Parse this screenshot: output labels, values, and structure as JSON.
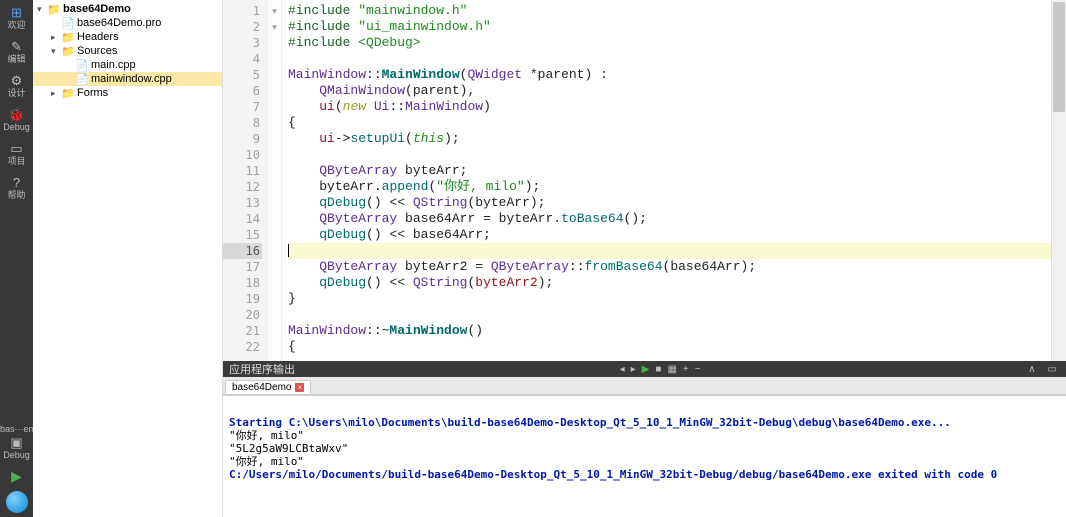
{
  "modeBar": {
    "items": [
      {
        "icon": "⊞",
        "label": "欢迎"
      },
      {
        "icon": "✎",
        "label": "编辑"
      },
      {
        "icon": "⚙",
        "label": "设计"
      },
      {
        "icon": "🐞",
        "label": "Debug"
      },
      {
        "icon": "▭",
        "label": "项目"
      },
      {
        "icon": "?",
        "label": "帮助"
      }
    ],
    "target": {
      "top": "bas···emo",
      "sub": "Debug"
    },
    "play": "▶"
  },
  "tree": [
    {
      "depth": 0,
      "arrow": "▾",
      "icon": "📁",
      "iconCls": "fold-blue",
      "label": "base64Demo",
      "bold": true,
      "sel": false
    },
    {
      "depth": 1,
      "arrow": "",
      "icon": "📄",
      "iconCls": "file-ic",
      "label": "base64Demo.pro",
      "bold": false,
      "sel": false
    },
    {
      "depth": 1,
      "arrow": "▸",
      "icon": "📁",
      "iconCls": "fold-yellow",
      "label": "Headers",
      "bold": false,
      "sel": false
    },
    {
      "depth": 1,
      "arrow": "▾",
      "icon": "📁",
      "iconCls": "fold-yellow",
      "label": "Sources",
      "bold": false,
      "sel": false
    },
    {
      "depth": 2,
      "arrow": "",
      "icon": "📄",
      "iconCls": "file-ic",
      "label": "main.cpp",
      "bold": false,
      "sel": false
    },
    {
      "depth": 2,
      "arrow": "",
      "icon": "📄",
      "iconCls": "file-ic",
      "label": "mainwindow.cpp",
      "bold": false,
      "sel": true
    },
    {
      "depth": 1,
      "arrow": "▸",
      "icon": "📁",
      "iconCls": "fold-yellow",
      "label": "Forms",
      "bold": false,
      "sel": false
    }
  ],
  "gutterCount": 22,
  "currentLine": 16,
  "foldMarks": {
    "7": "▾",
    "21": "▾"
  },
  "code": [
    [
      {
        "t": "#include ",
        "c": "tk-pp"
      },
      {
        "t": "\"mainwindow.h\"",
        "c": "tk-incpath"
      }
    ],
    [
      {
        "t": "#include ",
        "c": "tk-pp"
      },
      {
        "t": "\"ui_mainwindow.h\"",
        "c": "tk-incpath"
      }
    ],
    [
      {
        "t": "#include ",
        "c": "tk-pp"
      },
      {
        "t": "<QDebug>",
        "c": "tk-incpath"
      }
    ],
    [],
    [
      {
        "t": "MainWindow",
        "c": "tk-type"
      },
      {
        "t": "::"
      },
      {
        "t": "MainWindow",
        "c": "tk-fnbold"
      },
      {
        "t": "("
      },
      {
        "t": "QWidget",
        "c": "tk-type"
      },
      {
        "t": " *"
      },
      {
        "t": "parent",
        "c": ""
      },
      {
        "t": ") :"
      }
    ],
    [
      {
        "t": "    "
      },
      {
        "t": "QMainWindow",
        "c": "tk-type"
      },
      {
        "t": "("
      },
      {
        "t": "parent",
        "c": ""
      },
      {
        "t": "),"
      }
    ],
    [
      {
        "t": "    "
      },
      {
        "t": "ui",
        "c": "tk-var"
      },
      {
        "t": "("
      },
      {
        "t": "new",
        "c": "tk-kw"
      },
      {
        "t": " "
      },
      {
        "t": "Ui",
        "c": "tk-type"
      },
      {
        "t": "::"
      },
      {
        "t": "MainWindow",
        "c": "tk-type"
      },
      {
        "t": ")"
      }
    ],
    [
      {
        "t": "{"
      }
    ],
    [
      {
        "t": "    "
      },
      {
        "t": "ui",
        "c": "tk-var"
      },
      {
        "t": "->"
      },
      {
        "t": "setupUi",
        "c": "tk-fn"
      },
      {
        "t": "("
      },
      {
        "t": "this",
        "c": "tk-this"
      },
      {
        "t": ");"
      }
    ],
    [],
    [
      {
        "t": "    "
      },
      {
        "t": "QByteArray",
        "c": "tk-type"
      },
      {
        "t": " "
      },
      {
        "t": "byteArr",
        "c": ""
      },
      {
        "t": ";"
      }
    ],
    [
      {
        "t": "    "
      },
      {
        "t": "byteArr",
        "c": ""
      },
      {
        "t": "."
      },
      {
        "t": "append",
        "c": "tk-fn"
      },
      {
        "t": "("
      },
      {
        "t": "\"你好, milo\"",
        "c": "tk-str"
      },
      {
        "t": ");"
      }
    ],
    [
      {
        "t": "    "
      },
      {
        "t": "qDebug",
        "c": "tk-fn"
      },
      {
        "t": "() << "
      },
      {
        "t": "QString",
        "c": "tk-type"
      },
      {
        "t": "("
      },
      {
        "t": "byteArr",
        "c": ""
      },
      {
        "t": ");"
      }
    ],
    [
      {
        "t": "    "
      },
      {
        "t": "QByteArray",
        "c": "tk-type"
      },
      {
        "t": " "
      },
      {
        "t": "base64Arr",
        "c": ""
      },
      {
        "t": " = "
      },
      {
        "t": "byteArr",
        "c": ""
      },
      {
        "t": "."
      },
      {
        "t": "toBase64",
        "c": "tk-fn"
      },
      {
        "t": "();"
      }
    ],
    [
      {
        "t": "    "
      },
      {
        "t": "qDebug",
        "c": "tk-fn"
      },
      {
        "t": "() << "
      },
      {
        "t": "base64Arr",
        "c": ""
      },
      {
        "t": ";"
      }
    ],
    [],
    [
      {
        "t": "    "
      },
      {
        "t": "QByteArray",
        "c": "tk-type"
      },
      {
        "t": " "
      },
      {
        "t": "byteArr2",
        "c": ""
      },
      {
        "t": " = "
      },
      {
        "t": "QByteArray",
        "c": "tk-type"
      },
      {
        "t": "::"
      },
      {
        "t": "fromBase64",
        "c": "tk-fn"
      },
      {
        "t": "("
      },
      {
        "t": "base64Arr",
        "c": ""
      },
      {
        "t": ");"
      }
    ],
    [
      {
        "t": "    "
      },
      {
        "t": "qDebug",
        "c": "tk-fn"
      },
      {
        "t": "() << "
      },
      {
        "t": "QString",
        "c": "tk-type"
      },
      {
        "t": "("
      },
      {
        "t": "byteArr2",
        "c": "tk-var"
      },
      {
        "t": ");"
      }
    ],
    [
      {
        "t": "}"
      }
    ],
    [],
    [
      {
        "t": "MainWindow",
        "c": "tk-type"
      },
      {
        "t": "::~"
      },
      {
        "t": "MainWindow",
        "c": "tk-fnbold"
      },
      {
        "t": "()"
      }
    ],
    [
      {
        "t": "{"
      }
    ]
  ],
  "output": {
    "title": "应用程序输出",
    "tools": [
      "◂",
      "▸",
      "▶",
      "■",
      "▦",
      "+",
      "−"
    ],
    "rightTools": [
      "∧",
      "▭"
    ],
    "tab": "base64Demo",
    "lines": [
      {
        "t": "Starting C:\\Users\\milo\\Documents\\build-base64Demo-Desktop_Qt_5_10_1_MinGW_32bit-Debug\\debug\\base64Demo.exe...",
        "c": "out-bold"
      },
      {
        "t": "\"你好, milo\"",
        "c": ""
      },
      {
        "t": "\"5L2g5aW9LCBtaWxv\"",
        "c": ""
      },
      {
        "t": "\"你好, milo\"",
        "c": ""
      },
      {
        "t": "C:/Users/milo/Documents/build-base64Demo-Desktop_Qt_5_10_1_MinGW_32bit-Debug/debug/base64Demo.exe exited with code 0",
        "c": "out-navy"
      }
    ]
  }
}
